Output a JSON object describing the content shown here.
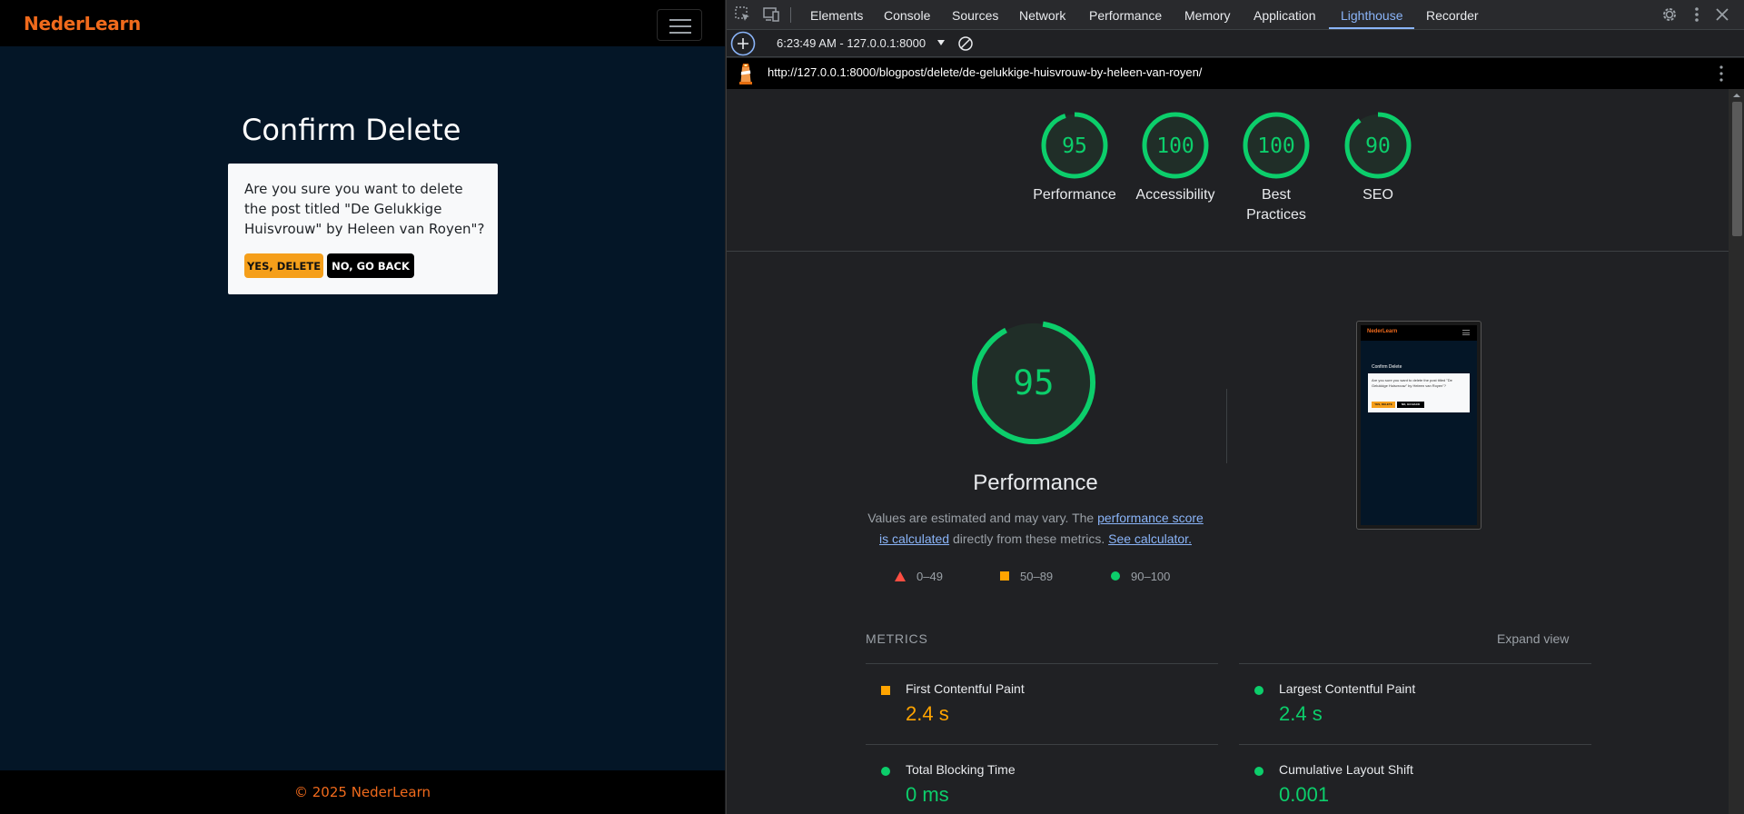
{
  "site": {
    "brand": "NederLearn",
    "confirm_title": "Confirm Delete",
    "confirm_text": "Are you sure you want to delete the post titled \"De Gelukkige Huisvrouw\" by Heleen van Royen\"?",
    "yes_button": "YES, DELETE",
    "no_button": "NO, GO BACK",
    "footer": "© 2025 NederLearn",
    "brand_color": "#f06a1c",
    "background_color": "#041627"
  },
  "devtools": {
    "tabs": [
      "Elements",
      "Console",
      "Sources",
      "Network",
      "Performance",
      "Memory",
      "Application",
      "Lighthouse",
      "Recorder"
    ],
    "active_tab": "Lighthouse",
    "report_select": "6:23:49 AM - 127.0.0.1:8000",
    "url": "http://127.0.0.1:8000/blogpost/delete/de-gelukkige-huisvrouw-by-heleen-van-royen/"
  },
  "lighthouse": {
    "scores": [
      {
        "label": "Performance",
        "value": 95
      },
      {
        "label": "Accessibility",
        "value": 100
      },
      {
        "label": "Best Practices",
        "value": 100
      },
      {
        "label": "SEO",
        "value": 90
      }
    ],
    "performance": {
      "score": 95,
      "title": "Performance",
      "desc_1": "Values are estimated and may vary. The ",
      "desc_link_1": "performance score is calculated",
      "desc_2": " directly from these metrics. ",
      "desc_link_2": "See calculator."
    },
    "legend": [
      {
        "range": "0–49",
        "shape": "triangle",
        "color": "#ff4e42"
      },
      {
        "range": "50–89",
        "shape": "square",
        "color": "#ffa400"
      },
      {
        "range": "90–100",
        "shape": "circle",
        "color": "#0cce6b"
      }
    ],
    "screenshot": {
      "brand": "NederLearn",
      "title": "Confirm Delete",
      "text": "Are you sure you want to delete the post titled \"De Gelukkige Huisvrouw\" by Heleen van Royen\"?",
      "yes": "YES, DELETE",
      "no": "NO, GO BACK"
    },
    "metrics_title": "METRICS",
    "expand_view": "Expand view",
    "metrics": [
      {
        "label": "First Contentful Paint",
        "value": "2.4 s",
        "status": "orange"
      },
      {
        "label": "Largest Contentful Paint",
        "value": "2.4 s",
        "status": "green"
      },
      {
        "label": "Total Blocking Time",
        "value": "0 ms",
        "status": "green"
      },
      {
        "label": "Cumulative Layout Shift",
        "value": "0.001",
        "status": "green"
      }
    ],
    "colors": {
      "pass": "#0cce6b",
      "average": "#ffa400",
      "fail": "#ff4e42"
    }
  }
}
